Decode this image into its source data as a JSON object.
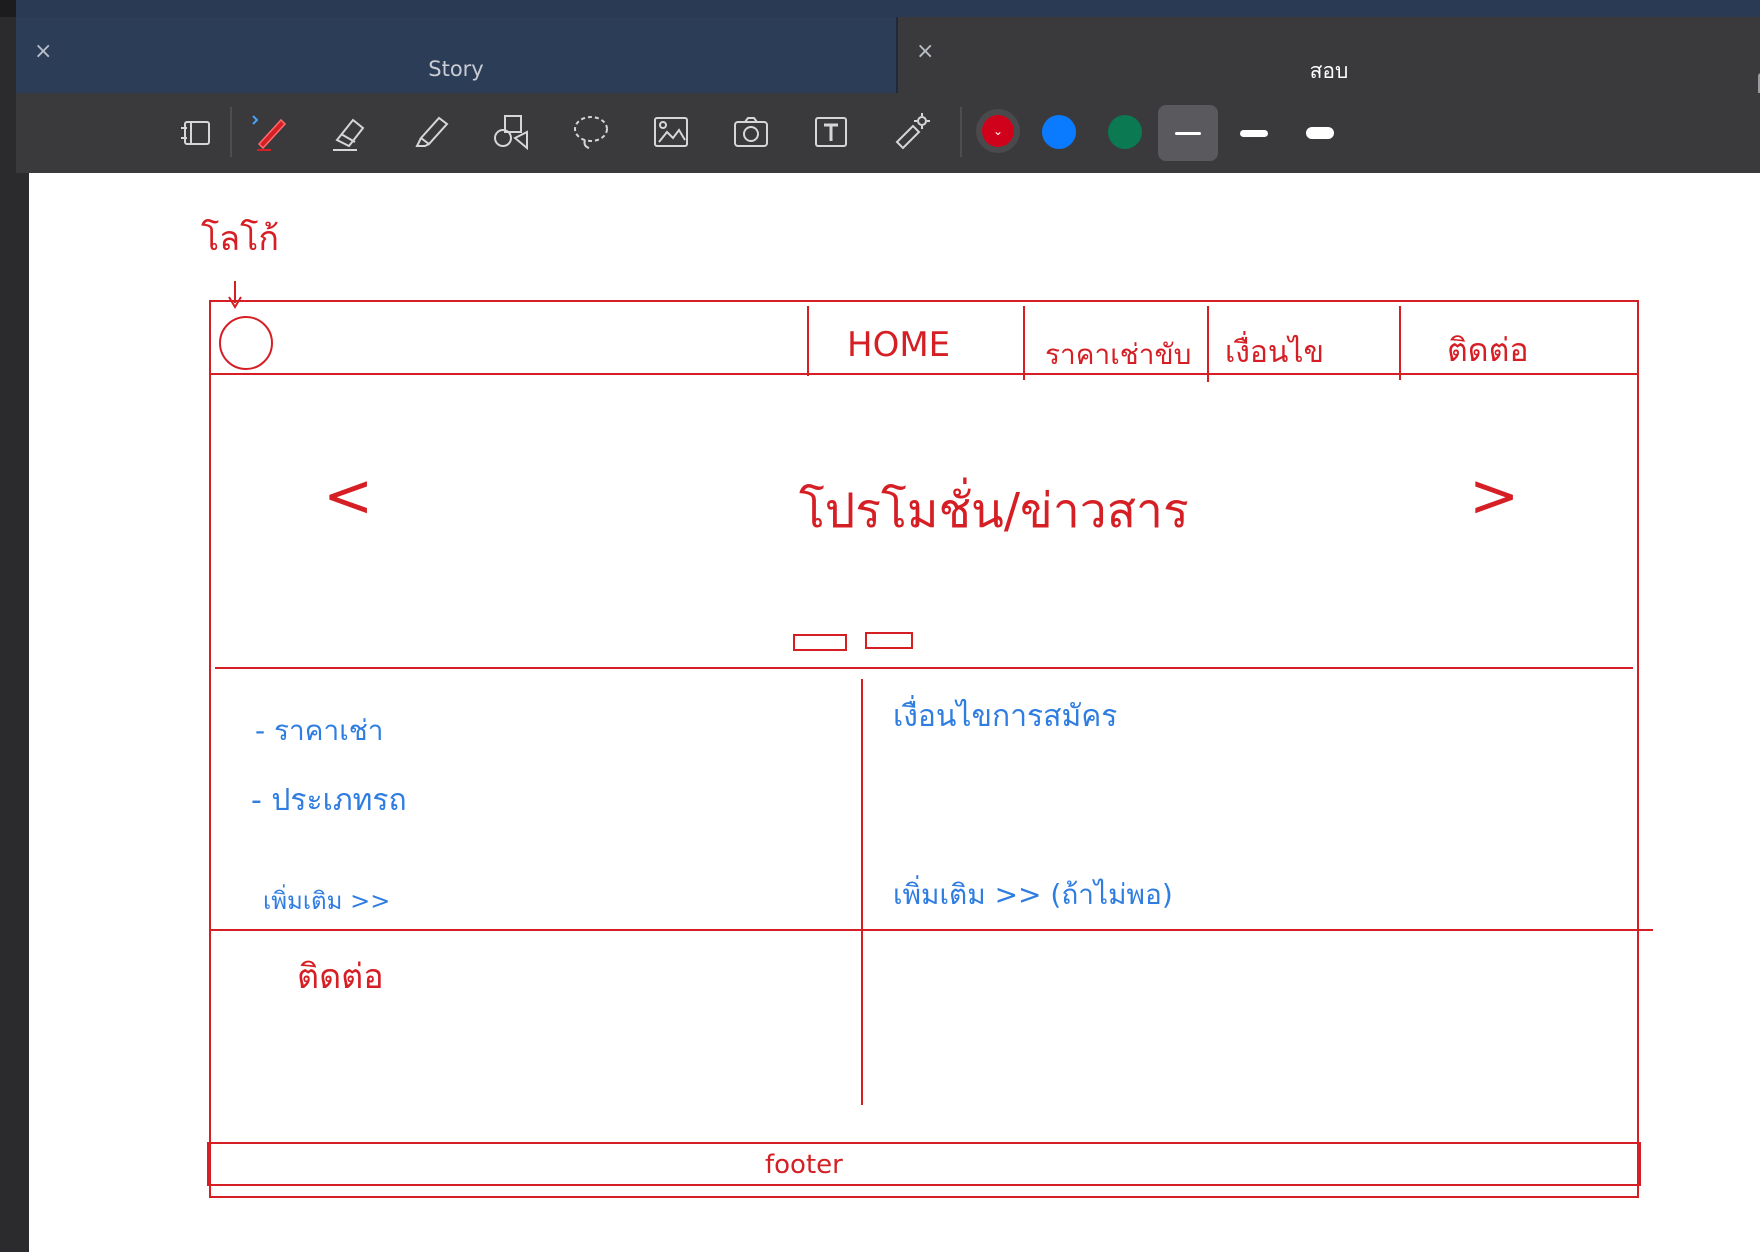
{
  "tabs": [
    {
      "title": "Story",
      "close": "×"
    },
    {
      "title": "สอบ",
      "close": "×"
    }
  ],
  "toolbar": {
    "tools": [
      "reader-mode-icon",
      "pen-icon",
      "eraser-icon",
      "highlighter-icon",
      "shapes-icon",
      "lasso-icon",
      "image-icon",
      "camera-icon",
      "text-box-icon",
      "laser-pointer-icon"
    ],
    "colors": [
      {
        "name": "red",
        "hex": "#d0021b",
        "selected": true
      },
      {
        "name": "blue",
        "hex": "#0a7aff",
        "selected": false
      },
      {
        "name": "green",
        "hex": "#0b7a52",
        "selected": false
      }
    ],
    "stroke_widths": [
      "thin",
      "medium",
      "thick"
    ],
    "selected_width": "thin"
  },
  "sketch": {
    "logo_label": "โลโก้",
    "nav": [
      "HOME",
      "ราคาเช่าขับ",
      "เงื่อนไข",
      "ติดต่อ"
    ],
    "slider_prev": "<",
    "slider_next": ">",
    "banner_text": "โปรโมชั่น/ข่าวสาร",
    "left_items": [
      "- ราคาเช่า",
      "- ประเภทรถ"
    ],
    "left_more": "เพิ่มเติม >>",
    "right_title": "เงื่อนไขการสมัคร",
    "right_more": "เพิ่มเติม >> (ถ้าไม่พอ)",
    "contact": "ติดต่อ",
    "footer": "footer"
  },
  "colors": {
    "ink_red": "#d51f25",
    "ink_blue": "#2f7de1"
  }
}
